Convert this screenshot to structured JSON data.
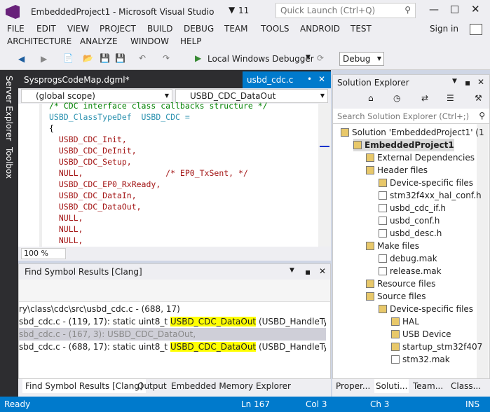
{
  "title": "EmbeddedProject1 - Microsoft Visual Studio",
  "notifications": "11",
  "quick_launch_placeholder": "Quick Launch (Ctrl+Q)",
  "user": "Sign in",
  "menu": [
    "FILE",
    "EDIT",
    "VIEW",
    "PROJECT",
    "BUILD",
    "DEBUG",
    "TEAM",
    "TOOLS",
    "ANDROID",
    "TEST",
    "ARCHITECTURE",
    "ANALYZE",
    "WINDOW",
    "HELP"
  ],
  "toolbar": {
    "debugger": "Local Windows Debugger",
    "config": "Debug"
  },
  "left_tabs": [
    "Server Explorer",
    "Toolbox"
  ],
  "editor": {
    "tab_inactive": "SysprogsCodeMap.dgml*",
    "tab_active": "usbd_cdc.c",
    "scope": "(global scope)",
    "member": "USBD_CDC_DataOut",
    "zoom": "100 %",
    "lines": [
      {
        "a": "/* CDC interface class callbacks structure */",
        "t": "cm"
      },
      {
        "a": "USBD_ClassTypeDef  USBD_CDC =",
        "t": "mix"
      },
      {
        "a": "{",
        "t": "plain"
      },
      {
        "a": "  USBD_CDC_Init,",
        "t": "kw"
      },
      {
        "a": "  USBD_CDC_DeInit,",
        "t": "kw"
      },
      {
        "a": "  USBD_CDC_Setup,",
        "t": "kw"
      },
      {
        "a": "  NULL,                 /* EP0_TxSent, */",
        "t": "nullcm"
      },
      {
        "a": "  USBD_CDC_EP0_RxReady,",
        "t": "kw"
      },
      {
        "a": "  USBD_CDC_DataIn,",
        "t": "kw"
      },
      {
        "a": "  USBD_CDC_DataOut,",
        "t": "kw"
      },
      {
        "a": "  NULL,",
        "t": "kw"
      },
      {
        "a": "  NULL,",
        "t": "kw"
      },
      {
        "a": "  NULL,",
        "t": "kw"
      }
    ]
  },
  "find": {
    "title": "Find Symbol Results [Clang]",
    "results": [
      {
        "pre": "ry\\class\\cdc\\src\\usbd_cdc.c - (688, 17)",
        "hl": "",
        "post": ""
      },
      {
        "pre": "sbd_cdc.c - (119, 17): static uint8_t ",
        "hl": "USBD_CDC_DataOut",
        "post": " (USBD_HandleTypeDef *p"
      },
      {
        "pre": "sbd_cdc.c - (167, 3): USBD_CDC_DataOut,",
        "hl": "",
        "post": ""
      },
      {
        "pre": "sbd_cdc.c - (688, 17): static uint8_t ",
        "hl": "USBD_CDC_DataOut",
        "post": " (USBD_HandleTypeDef *p"
      }
    ],
    "bottom_tabs": [
      "Find Symbol Results [Clang]",
      "Output",
      "Embedded Memory Explorer"
    ]
  },
  "solution_explorer": {
    "title": "Solution Explorer",
    "search_placeholder": "Search Solution Explorer (Ctrl+;)",
    "items": [
      {
        "label": "Solution 'EmbeddedProject1' (1",
        "indent": 0
      },
      {
        "label": "EmbeddedProject1",
        "indent": 1
      },
      {
        "label": "External Dependencies",
        "indent": 2
      },
      {
        "label": "Header files",
        "indent": 2
      },
      {
        "label": "Device-specific files",
        "indent": 3
      },
      {
        "label": "stm32f4xx_hal_conf.h",
        "indent": 3
      },
      {
        "label": "usbd_cdc_if.h",
        "indent": 3
      },
      {
        "label": "usbd_conf.h",
        "indent": 3
      },
      {
        "label": "usbd_desc.h",
        "indent": 3
      },
      {
        "label": "Make files",
        "indent": 2
      },
      {
        "label": "debug.mak",
        "indent": 3
      },
      {
        "label": "release.mak",
        "indent": 3
      },
      {
        "label": "Resource files",
        "indent": 2
      },
      {
        "label": "Source files",
        "indent": 2
      },
      {
        "label": "Device-specific files",
        "indent": 3
      },
      {
        "label": "HAL",
        "indent": 4
      },
      {
        "label": "USB Device",
        "indent": 4
      },
      {
        "label": "startup_stm32f407",
        "indent": 4
      },
      {
        "label": "stm32.mak",
        "indent": 4
      }
    ],
    "bottom_tabs": [
      "Proper...",
      "Soluti...",
      "Team...",
      "Class..."
    ]
  },
  "status": {
    "state": "Ready",
    "ln": "Ln 167",
    "col": "Col 3",
    "ch": "Ch 3",
    "mode": "INS"
  }
}
